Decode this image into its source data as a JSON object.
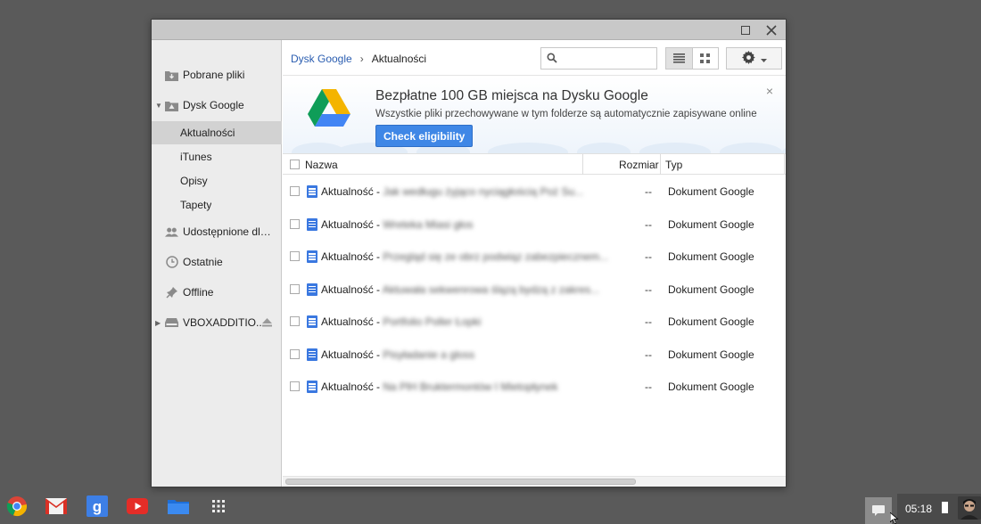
{
  "window": {
    "maximize_icon": "maximize-icon",
    "close_icon": "close-icon"
  },
  "sidebar": {
    "items": [
      {
        "label": "Pobrane pliki",
        "icon": "downloads-folder-icon"
      },
      {
        "label": "Dysk Google",
        "icon": "drive-folder-icon"
      },
      {
        "label": "Aktualności"
      },
      {
        "label": "iTunes"
      },
      {
        "label": "Opisy"
      },
      {
        "label": "Tapety"
      },
      {
        "label": "Udostępnione dla ...",
        "icon": "shared-people-icon"
      },
      {
        "label": "Ostatnie",
        "icon": "clock-icon"
      },
      {
        "label": "Offline",
        "icon": "pin-icon"
      },
      {
        "label": "VBOXADDITIO...",
        "icon": "drive-icon"
      }
    ],
    "selected": "Aktualności"
  },
  "header": {
    "breadcrumb": [
      "Dysk Google",
      "Aktualności"
    ],
    "breadcrumb_separator": "›",
    "search_value": ""
  },
  "banner": {
    "title": "Bezpłatne 100 GB miejsca na Dysku Google",
    "subtitle": "Wszystkie pliki przechowywane w tym folderze są automatycznie zapisywane online",
    "cta_label": "Check eligibility",
    "close": "×"
  },
  "table": {
    "columns": [
      "Nazwa",
      "Rozmiar",
      "Typ"
    ],
    "rows": [
      {
        "prefix": "Aktualność - ",
        "hidden": "Jak wedługu żyjąco nyciągłością Poż Su...",
        "size": "--",
        "type": "Dokument Google"
      },
      {
        "prefix": "Aktualność - ",
        "hidden": "Wreteka Miasi głos",
        "size": "--",
        "type": "Dokument Google"
      },
      {
        "prefix": "Aktualność - ",
        "hidden": "Przegląd się ze obrz podwiąz zabezpiecznem...",
        "size": "--",
        "type": "Dokument Google"
      },
      {
        "prefix": "Aktualność - ",
        "hidden": "Aktuwała sekwenrowa ślązą bydzą z zakres...",
        "size": "--",
        "type": "Dokument Google"
      },
      {
        "prefix": "Aktualność - ",
        "hidden": "Portfolio Poller Łopki",
        "size": "--",
        "type": "Dokument Google"
      },
      {
        "prefix": "Aktualność - ",
        "hidden": "Pisyładanie a gloss",
        "size": "--",
        "type": "Dokument Google"
      },
      {
        "prefix": "Aktualność - ",
        "hidden": "Na PlH Bruktermontów I Mietopłynek",
        "size": "--",
        "type": "Dokument Google"
      }
    ]
  },
  "shelf": {
    "apps": [
      "chrome-icon",
      "gmail-icon",
      "google-search-icon",
      "youtube-icon",
      "files-icon",
      "app-launcher-icon"
    ],
    "clock": "05:18"
  },
  "colors": {
    "accent": "#3f87e6",
    "link": "#2a5db0",
    "desktop": "#5a5a5a"
  }
}
